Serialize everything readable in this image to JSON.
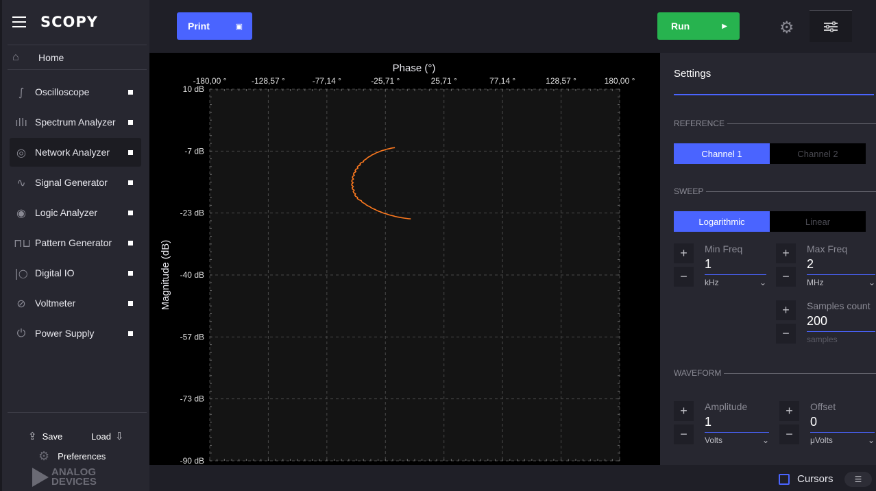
{
  "app": {
    "logo": "SCOPY"
  },
  "sidebar": {
    "home": {
      "label": "Home"
    },
    "items": [
      {
        "label": "Oscilloscope",
        "icon": "oscilloscope-icon"
      },
      {
        "label": "Spectrum Analyzer",
        "icon": "spectrum-icon"
      },
      {
        "label": "Network Analyzer",
        "icon": "network-icon",
        "active": true
      },
      {
        "label": "Signal Generator",
        "icon": "signal-icon"
      },
      {
        "label": "Logic Analyzer",
        "icon": "logic-icon"
      },
      {
        "label": "Pattern Generator",
        "icon": "pattern-icon"
      },
      {
        "label": "Digital IO",
        "icon": "digital-io-icon"
      },
      {
        "label": "Voltmeter",
        "icon": "voltmeter-icon"
      },
      {
        "label": "Power Supply",
        "icon": "power-icon"
      }
    ],
    "save_label": "Save",
    "load_label": "Load",
    "preferences_label": "Preferences",
    "brand_line1": "ANALOG",
    "brand_line2": "DEVICES"
  },
  "toolbar": {
    "print_label": "Print",
    "run_label": "Run"
  },
  "plot": {
    "x_title": "Phase (°)",
    "y_title": "Magnitude (dB)",
    "x_ticks": [
      "-180,00 °",
      "-128,57 °",
      "-77,14 °",
      "-25,71 °",
      "25,71 °",
      "77,14 °",
      "128,57 °",
      "180,00 °"
    ],
    "y_ticks": [
      "10 dB",
      "-7 dB",
      "-23 dB",
      "-40 dB",
      "-57 dB",
      "-73 dB",
      "-90 dB"
    ],
    "trace_color": "#ff7a1f"
  },
  "settings": {
    "title": "Settings",
    "reference_label": "REFERENCE",
    "channel1": "Channel 1",
    "channel2": "Channel 2",
    "sweep_label": "SWEEP",
    "logarithmic": "Logarithmic",
    "linear": "Linear",
    "min_freq": {
      "caption": "Min Freq",
      "value": "1",
      "unit": "kHz"
    },
    "max_freq": {
      "caption": "Max Freq",
      "value": "2",
      "unit": "MHz"
    },
    "samples": {
      "caption": "Samples count",
      "value": "200",
      "unit": "samples"
    },
    "waveform_label": "WAVEFORM",
    "amplitude": {
      "caption": "Amplitude",
      "value": "1",
      "unit": "Volts"
    },
    "offset": {
      "caption": "Offset",
      "value": "0",
      "unit": "μVolts"
    }
  },
  "bottom": {
    "cursors_label": "Cursors"
  },
  "colors": {
    "accent": "#4a64ff",
    "run": "#27b34f",
    "trace": "#ff7a1f"
  }
}
